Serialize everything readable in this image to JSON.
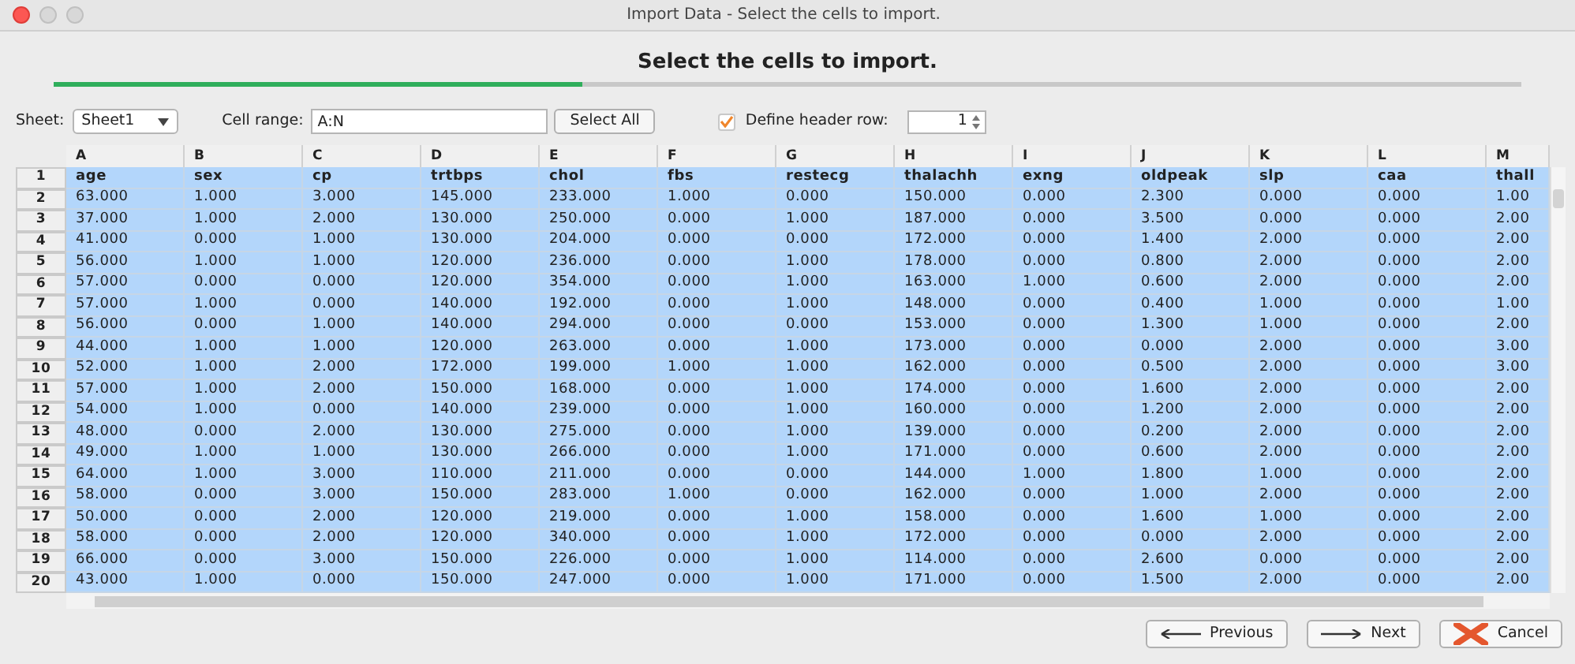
{
  "window": {
    "title": "Import Data - Select the cells to import."
  },
  "heading": "Select the cells to import.",
  "progress": {
    "level": 0.36
  },
  "sheet": {
    "label": "Sheet:",
    "value": "Sheet1"
  },
  "cell_range": {
    "label": "Cell range:",
    "value": "A:N"
  },
  "select_all_button": "Select All",
  "header_row": {
    "label": "Define header row:",
    "checked": true,
    "value": "1"
  },
  "table": {
    "columns": [
      "A",
      "B",
      "C",
      "D",
      "E",
      "F",
      "G",
      "H",
      "I",
      "J",
      "K",
      "L",
      "M"
    ],
    "rows": [
      {
        "number": "1",
        "cells": [
          "age",
          "sex",
          "cp",
          "trtbps",
          "chol",
          "fbs",
          "restecg",
          "thalachh",
          "exng",
          "oldpeak",
          "slp",
          "caa",
          "thall"
        ]
      },
      {
        "number": "2",
        "cells": [
          "63.000",
          "1.000",
          "3.000",
          "145.000",
          "233.000",
          "1.000",
          "0.000",
          "150.000",
          "0.000",
          "2.300",
          "0.000",
          "0.000",
          "1.00"
        ]
      },
      {
        "number": "3",
        "cells": [
          "37.000",
          "1.000",
          "2.000",
          "130.000",
          "250.000",
          "0.000",
          "1.000",
          "187.000",
          "0.000",
          "3.500",
          "0.000",
          "0.000",
          "2.00"
        ]
      },
      {
        "number": "4",
        "cells": [
          "41.000",
          "0.000",
          "1.000",
          "130.000",
          "204.000",
          "0.000",
          "0.000",
          "172.000",
          "0.000",
          "1.400",
          "2.000",
          "0.000",
          "2.00"
        ]
      },
      {
        "number": "5",
        "cells": [
          "56.000",
          "1.000",
          "1.000",
          "120.000",
          "236.000",
          "0.000",
          "1.000",
          "178.000",
          "0.000",
          "0.800",
          "2.000",
          "0.000",
          "2.00"
        ]
      },
      {
        "number": "6",
        "cells": [
          "57.000",
          "0.000",
          "0.000",
          "120.000",
          "354.000",
          "0.000",
          "1.000",
          "163.000",
          "1.000",
          "0.600",
          "2.000",
          "0.000",
          "2.00"
        ]
      },
      {
        "number": "7",
        "cells": [
          "57.000",
          "1.000",
          "0.000",
          "140.000",
          "192.000",
          "0.000",
          "1.000",
          "148.000",
          "0.000",
          "0.400",
          "1.000",
          "0.000",
          "1.00"
        ]
      },
      {
        "number": "8",
        "cells": [
          "56.000",
          "0.000",
          "1.000",
          "140.000",
          "294.000",
          "0.000",
          "0.000",
          "153.000",
          "0.000",
          "1.300",
          "1.000",
          "0.000",
          "2.00"
        ]
      },
      {
        "number": "9",
        "cells": [
          "44.000",
          "1.000",
          "1.000",
          "120.000",
          "263.000",
          "0.000",
          "1.000",
          "173.000",
          "0.000",
          "0.000",
          "2.000",
          "0.000",
          "3.00"
        ]
      },
      {
        "number": "10",
        "cells": [
          "52.000",
          "1.000",
          "2.000",
          "172.000",
          "199.000",
          "1.000",
          "1.000",
          "162.000",
          "0.000",
          "0.500",
          "2.000",
          "0.000",
          "3.00"
        ]
      },
      {
        "number": "11",
        "cells": [
          "57.000",
          "1.000",
          "2.000",
          "150.000",
          "168.000",
          "0.000",
          "1.000",
          "174.000",
          "0.000",
          "1.600",
          "2.000",
          "0.000",
          "2.00"
        ]
      },
      {
        "number": "12",
        "cells": [
          "54.000",
          "1.000",
          "0.000",
          "140.000",
          "239.000",
          "0.000",
          "1.000",
          "160.000",
          "0.000",
          "1.200",
          "2.000",
          "0.000",
          "2.00"
        ]
      },
      {
        "number": "13",
        "cells": [
          "48.000",
          "0.000",
          "2.000",
          "130.000",
          "275.000",
          "0.000",
          "1.000",
          "139.000",
          "0.000",
          "0.200",
          "2.000",
          "0.000",
          "2.00"
        ]
      },
      {
        "number": "14",
        "cells": [
          "49.000",
          "1.000",
          "1.000",
          "130.000",
          "266.000",
          "0.000",
          "1.000",
          "171.000",
          "0.000",
          "0.600",
          "2.000",
          "0.000",
          "2.00"
        ]
      },
      {
        "number": "15",
        "cells": [
          "64.000",
          "1.000",
          "3.000",
          "110.000",
          "211.000",
          "0.000",
          "0.000",
          "144.000",
          "1.000",
          "1.800",
          "1.000",
          "0.000",
          "2.00"
        ]
      },
      {
        "number": "16",
        "cells": [
          "58.000",
          "0.000",
          "3.000",
          "150.000",
          "283.000",
          "1.000",
          "0.000",
          "162.000",
          "0.000",
          "1.000",
          "2.000",
          "0.000",
          "2.00"
        ]
      },
      {
        "number": "17",
        "cells": [
          "50.000",
          "0.000",
          "2.000",
          "120.000",
          "219.000",
          "0.000",
          "1.000",
          "158.000",
          "0.000",
          "1.600",
          "1.000",
          "0.000",
          "2.00"
        ]
      },
      {
        "number": "18",
        "cells": [
          "58.000",
          "0.000",
          "2.000",
          "120.000",
          "340.000",
          "0.000",
          "1.000",
          "172.000",
          "0.000",
          "0.000",
          "2.000",
          "0.000",
          "2.00"
        ]
      },
      {
        "number": "19",
        "cells": [
          "66.000",
          "0.000",
          "3.000",
          "150.000",
          "226.000",
          "0.000",
          "1.000",
          "114.000",
          "0.000",
          "2.600",
          "0.000",
          "0.000",
          "2.00"
        ]
      },
      {
        "number": "20",
        "cells": [
          "43.000",
          "1.000",
          "0.000",
          "150.000",
          "247.000",
          "0.000",
          "1.000",
          "171.000",
          "0.000",
          "1.500",
          "2.000",
          "0.000",
          "2.00"
        ]
      }
    ]
  },
  "buttons": [
    {
      "kind": "previous",
      "label": "Previous"
    },
    {
      "kind": "next",
      "label": "Next"
    },
    {
      "kind": "cancel",
      "label": "Cancel"
    }
  ]
}
